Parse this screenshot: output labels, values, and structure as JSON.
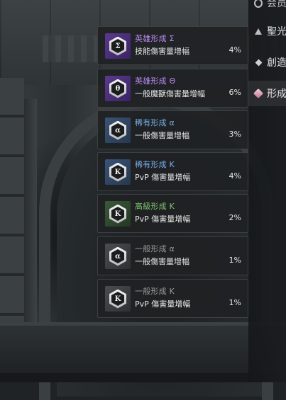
{
  "side_menu": {
    "items": [
      {
        "label": "会员",
        "icon": "ring-icon"
      },
      {
        "label": "聖光",
        "icon": "triangle-icon"
      },
      {
        "label": "創造",
        "icon": "diamond-icon"
      },
      {
        "label": "形成",
        "icon": "cube-icon"
      }
    ]
  },
  "effects": [
    {
      "symbol": "Σ",
      "name": "英雄形成 Σ",
      "effect": "技能傷害量增幅",
      "value": "4%",
      "grade": "hero"
    },
    {
      "symbol": "θ",
      "name": "英雄形成 Θ",
      "effect": "一般魔獸傷害量增幅",
      "value": "6%",
      "grade": "hero"
    },
    {
      "symbol": "α",
      "name": "稀有形成 α",
      "effect": "一般傷害量增幅",
      "value": "3%",
      "grade": "rare"
    },
    {
      "symbol": "K",
      "name": "稀有形成 K",
      "effect": "PvP 傷害量增幅",
      "value": "4%",
      "grade": "rare"
    },
    {
      "symbol": "K",
      "name": "高級形成 K",
      "effect": "PvP 傷害量增幅",
      "value": "2%",
      "grade": "advanced"
    },
    {
      "symbol": "α",
      "name": "一般形成 α",
      "effect": "一般傷害量增幅",
      "value": "1%",
      "grade": "normal"
    },
    {
      "symbol": "K",
      "name": "一般形成 K",
      "effect": "PvP 傷害量增幅",
      "value": "1%",
      "grade": "normal"
    }
  ],
  "colors": {
    "hero": "#b98bf2",
    "rare": "#79aee6",
    "advanced": "#7fc46f",
    "normal": "#9a9a9a"
  }
}
